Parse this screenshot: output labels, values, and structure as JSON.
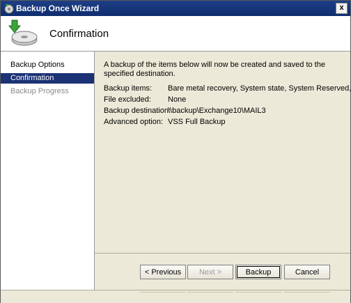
{
  "window": {
    "title": "Backup Once Wizard",
    "close_label": "x"
  },
  "header": {
    "title": "Confirmation"
  },
  "sidebar": {
    "items": [
      {
        "label": "Backup Options"
      },
      {
        "label": "Confirmation"
      },
      {
        "label": "Backup Progress"
      }
    ]
  },
  "main": {
    "intro": "A backup of the items below will now be created and saved to the specified destination.",
    "rows": [
      {
        "label": "Backup items:",
        "value": "Bare metal recovery, System state, System Reserved, L..."
      },
      {
        "label": "File excluded:",
        "value": "None"
      },
      {
        "label": "Backup destination:",
        "value": "\\\\backup\\Exchange10\\MAIL3"
      },
      {
        "label": "Advanced option:",
        "value": "VSS Full Backup"
      }
    ]
  },
  "buttons": {
    "previous": "< Previous",
    "next": "Next >",
    "backup": "Backup",
    "cancel": "Cancel"
  }
}
